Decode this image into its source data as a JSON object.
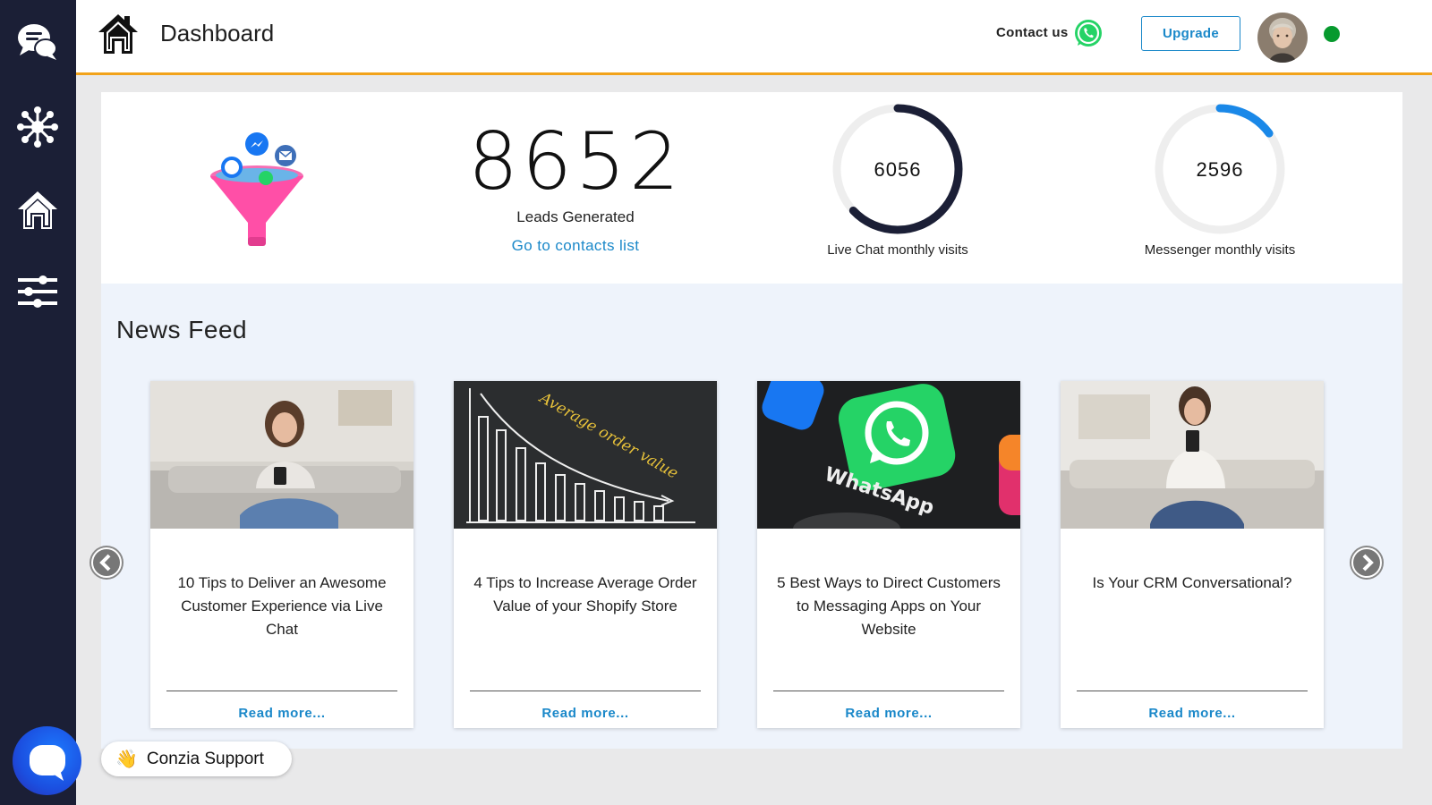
{
  "sidebar": {
    "icons": [
      "chat-bubbles-icon",
      "network-icon",
      "home-icon",
      "sliders-icon"
    ]
  },
  "header": {
    "title": "Dashboard",
    "contact_label": "Contact us",
    "upgrade_label": "Upgrade",
    "status_color": "#079a2e"
  },
  "stats": {
    "leads_value": "8652",
    "leads_label": "Leads Generated",
    "contacts_link": "Go to contacts list",
    "live_chat": {
      "value": "6056",
      "label": "Live Chat monthly visits",
      "progress": 0.63,
      "color": "#1b1f36"
    },
    "messenger": {
      "value": "2596",
      "label": "Messenger monthly visits",
      "progress": 0.15,
      "color": "#1a88e8"
    }
  },
  "news": {
    "title": "News Feed",
    "cards": [
      {
        "title": "10 Tips to Deliver an Awesome Customer Experience via Live Chat",
        "link": "Read more..."
      },
      {
        "title": "4 Tips to Increase Average Order Value of your Shopify Store",
        "link": "Read more...",
        "image_text": "Average order value"
      },
      {
        "title": "5 Best Ways to Direct Customers to Messaging Apps on Your Website",
        "link": "Read more...",
        "image_text": "WhatsApp"
      },
      {
        "title": "Is Your CRM Conversational?",
        "link": "Read more..."
      }
    ]
  },
  "support": {
    "label": "Conzia Support",
    "wave": "👋"
  },
  "colors": {
    "sidebar": "#1b1f36",
    "accent": "#1a88c9",
    "header_border": "#f2a31b"
  }
}
